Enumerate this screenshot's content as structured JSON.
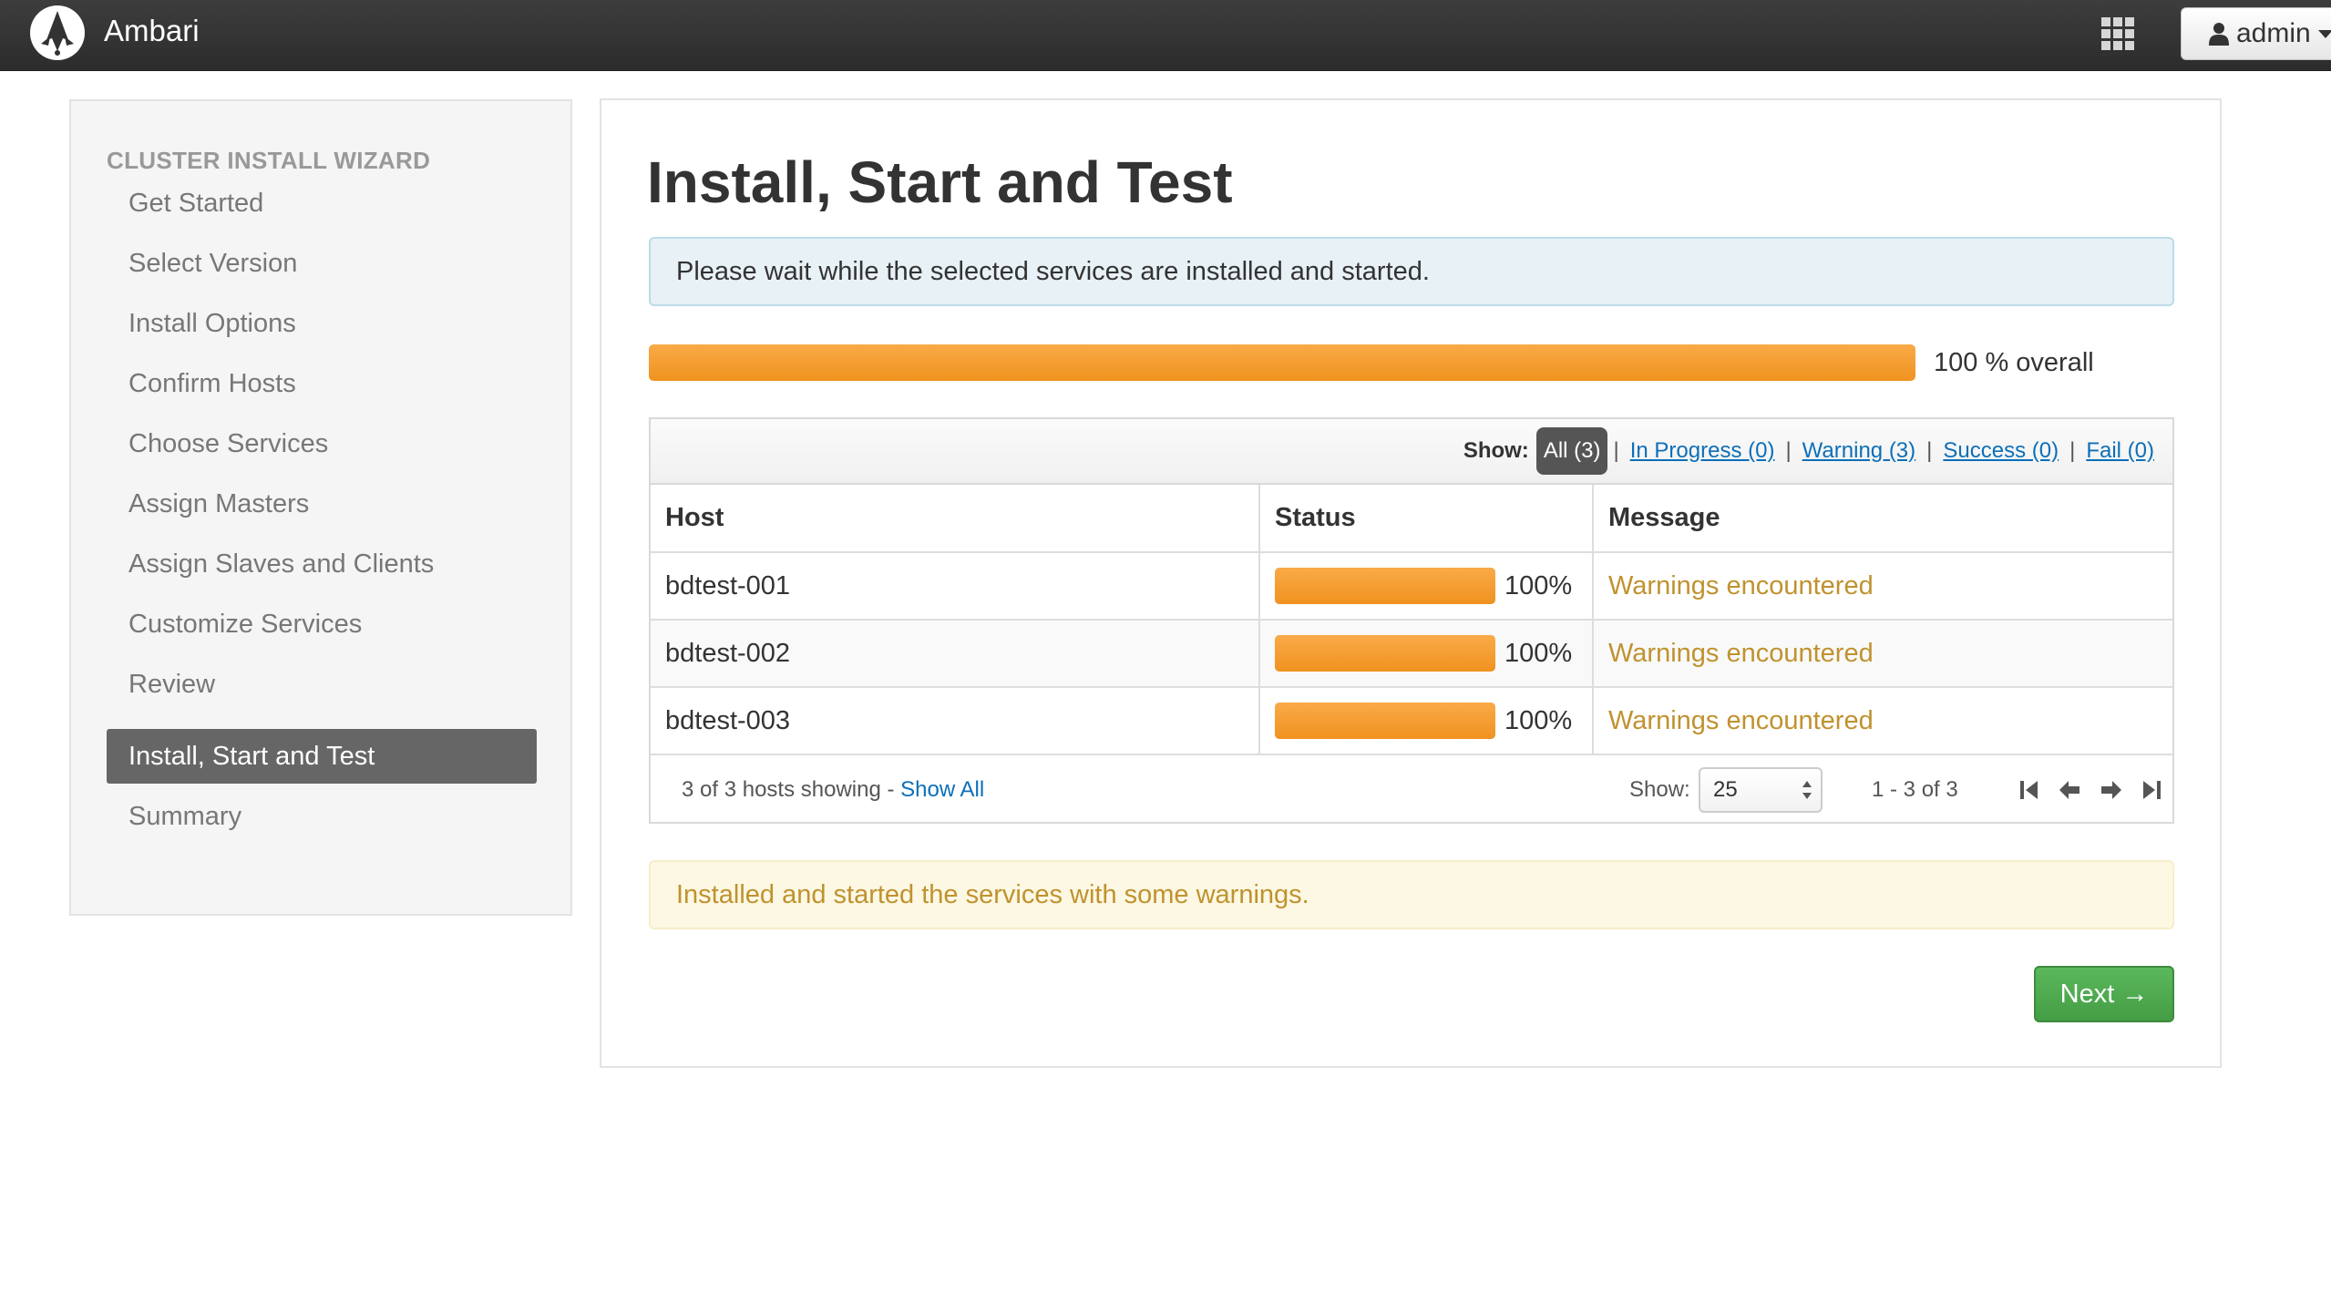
{
  "app": {
    "brand_name": "Ambari",
    "logo_icon": "ambari-logo-icon",
    "apps_icon": "grid-apps-icon",
    "user": {
      "name": "admin",
      "icon": "user-icon"
    }
  },
  "sidebar": {
    "title": "CLUSTER INSTALL WIZARD",
    "steps": [
      {
        "label": "Get Started",
        "active": false
      },
      {
        "label": "Select Version",
        "active": false
      },
      {
        "label": "Install Options",
        "active": false
      },
      {
        "label": "Confirm Hosts",
        "active": false
      },
      {
        "label": "Choose Services",
        "active": false
      },
      {
        "label": "Assign Masters",
        "active": false
      },
      {
        "label": "Assign Slaves and Clients",
        "active": false
      },
      {
        "label": "Customize Services",
        "active": false
      },
      {
        "label": "Review",
        "active": false
      },
      {
        "label": "Install, Start and Test",
        "active": true
      },
      {
        "label": "Summary",
        "active": false
      }
    ]
  },
  "main": {
    "title": "Install, Start and Test",
    "info_message": "Please wait while the selected services are installed and started.",
    "overall_progress": {
      "percent": 100,
      "label": "100 % overall"
    },
    "filters": {
      "show_label": "Show:",
      "active": "All (3)",
      "in_progress": "In Progress (0)",
      "warning": "Warning (3)",
      "success": "Success (0)",
      "fail": "Fail (0)",
      "separator": "|"
    },
    "table": {
      "headers": {
        "host": "Host",
        "status": "Status",
        "message": "Message"
      },
      "rows": [
        {
          "host": "bdtest-001",
          "percent": 100,
          "percent_label": "100%",
          "message": "Warnings encountered"
        },
        {
          "host": "bdtest-002",
          "percent": 100,
          "percent_label": "100%",
          "message": "Warnings encountered"
        },
        {
          "host": "bdtest-003",
          "percent": 100,
          "percent_label": "100%",
          "message": "Warnings encountered"
        }
      ]
    },
    "footer": {
      "count_text": "3 of 3 hosts showing - ",
      "show_all": "Show All",
      "show_label": "Show:",
      "page_size": "25",
      "range": "1 - 3 of 3",
      "pager_icons": [
        "first-page-icon",
        "prev-page-icon",
        "next-page-icon",
        "last-page-icon"
      ]
    },
    "warning_message": "Installed and started the services with some warnings.",
    "next_button": "Next →"
  },
  "colors": {
    "navbar": "#333333",
    "progress": "#f0921f",
    "warning_text": "#c0922f",
    "link": "#0d6fb8",
    "success_button": "#5cb85c",
    "active_step": "#666666"
  }
}
